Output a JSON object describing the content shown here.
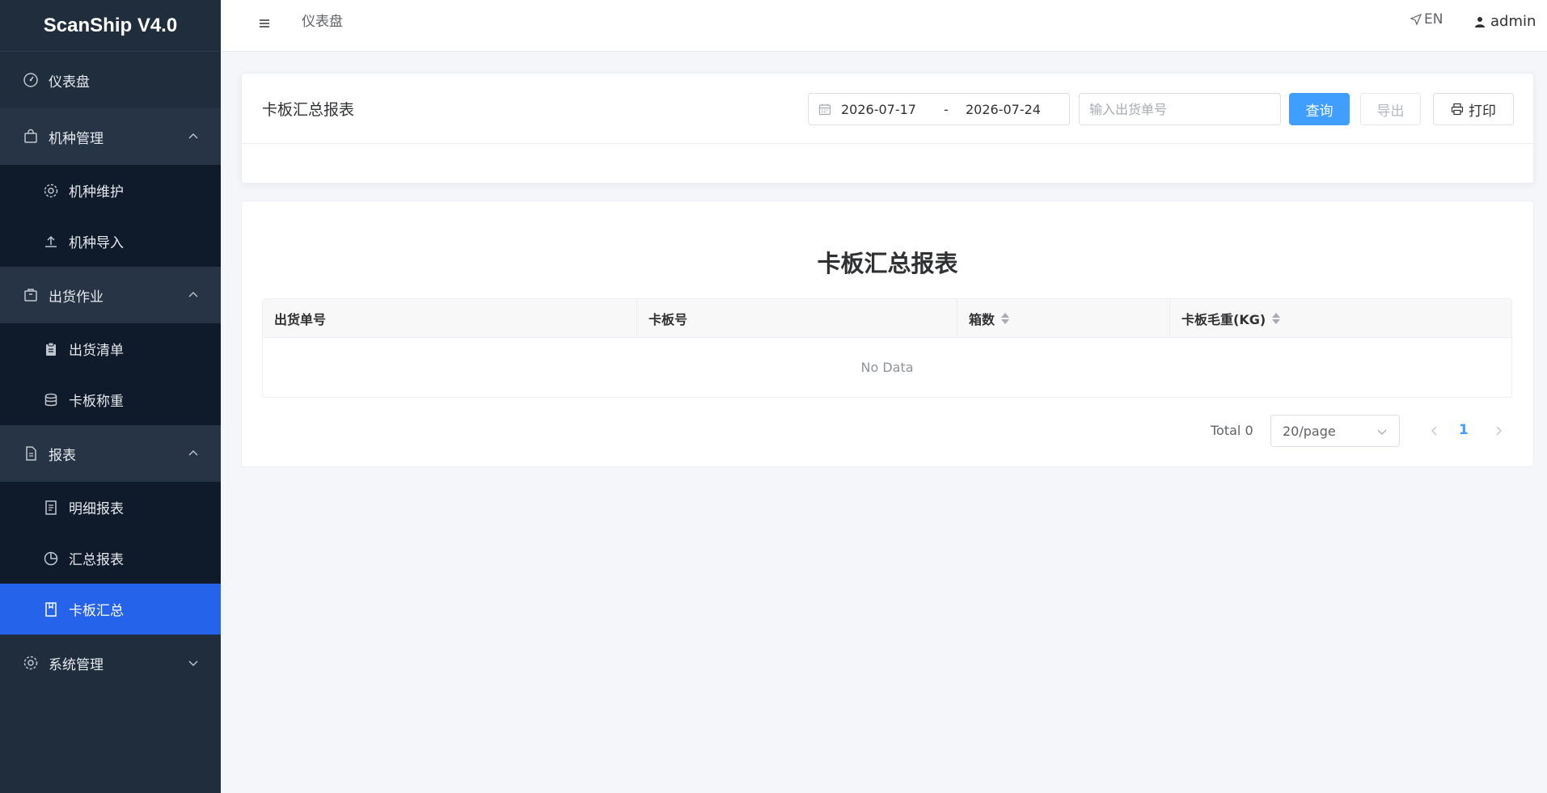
{
  "app": {
    "brand": "ScanShip V4.0"
  },
  "header": {
    "breadcrumb": "仪表盘",
    "lang_label": "EN",
    "user_name": "admin"
  },
  "sidebar": {
    "dashboard": "仪表盘",
    "models": {
      "label": "机种管理",
      "items": [
        "机种维护",
        "机种导入"
      ]
    },
    "shipping": {
      "label": "出货作业",
      "items": [
        "出货清单",
        "卡板称重"
      ]
    },
    "reports": {
      "label": "报表",
      "items": [
        "明细报表",
        "汇总报表",
        "卡板汇总"
      ]
    },
    "system": {
      "label": "系统管理"
    }
  },
  "filter": {
    "title": "卡板汇总报表",
    "date_start": "2026-07-17",
    "date_sep": "-",
    "date_end": "2026-07-24",
    "order_placeholder": "输入出货单号",
    "query_label": "查询",
    "export_label": "导出",
    "print_label": "打印"
  },
  "report": {
    "title": "卡板汇总报表",
    "columns": [
      "出货单号",
      "卡板号",
      "箱数",
      "卡板毛重(KG)"
    ],
    "empty_text": "No Data"
  },
  "pagination": {
    "total": "Total 0",
    "page_size": "20/page",
    "current_page": "1"
  },
  "colors": {
    "sidebar_bg": "#1f2d3d",
    "active_item": "#2563eb",
    "primary": "#409eff"
  }
}
